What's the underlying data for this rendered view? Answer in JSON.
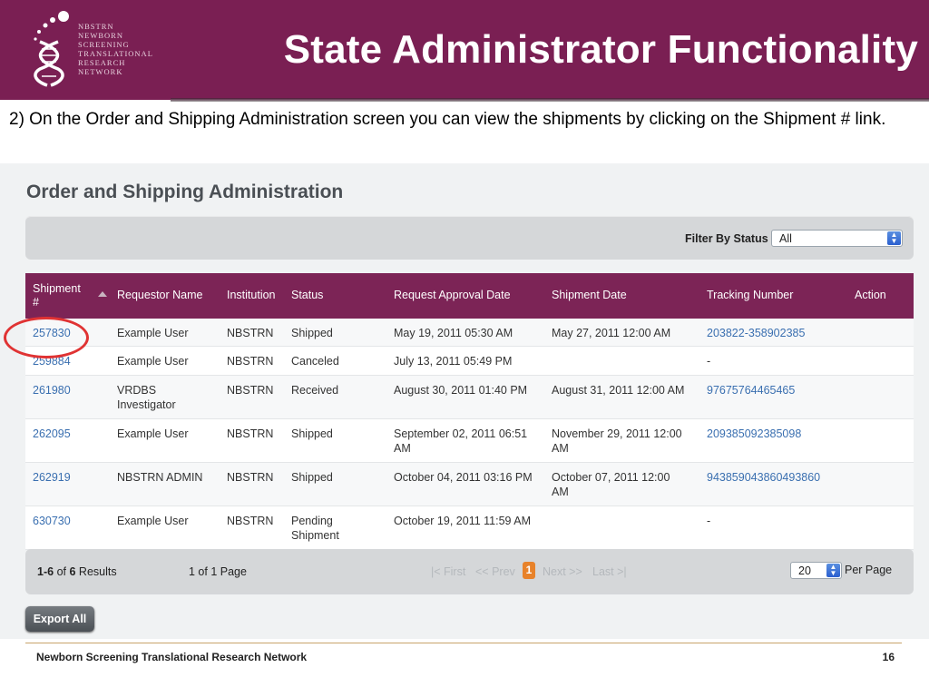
{
  "slide": {
    "title": "State Administrator Functionality",
    "logo_lines": [
      "NBSTRN",
      "NEWBORN",
      "SCREENING",
      "TRANSLATIONAL",
      "RESEARCH",
      "NETWORK"
    ],
    "instruction": "2) On the Order and Shipping Administration screen you can view the shipments by clicking on the Shipment # link.",
    "footer_text": "Newborn Screening Translational Research Network",
    "page_number": "16"
  },
  "app": {
    "title": "Order and Shipping Administration",
    "filter": {
      "label": "Filter By Status",
      "selected": "All"
    },
    "table": {
      "headers": {
        "shipment": "Shipment #",
        "requestor": "Requestor Name",
        "institution": "Institution",
        "status": "Status",
        "approval": "Request Approval Date",
        "shipment_date": "Shipment Date",
        "tracking": "Tracking Number",
        "action": "Action"
      },
      "rows": [
        {
          "shipment": "257830",
          "requestor": "Example User",
          "institution": "NBSTRN",
          "status": "Shipped",
          "approval": "May 19, 2011 05:30 AM",
          "shipment_date": "May 27, 2011 12:00 AM",
          "tracking": "203822-358902385"
        },
        {
          "shipment": "259884",
          "requestor": "Example User",
          "institution": "NBSTRN",
          "status": "Canceled",
          "approval": "July 13, 2011 05:49 PM",
          "shipment_date": "",
          "tracking": "-"
        },
        {
          "shipment": "261980",
          "requestor": "VRDBS Investigator",
          "institution": "NBSTRN",
          "status": "Received",
          "approval": "August 30, 2011 01:40 PM",
          "shipment_date": "August 31, 2011 12:00 AM",
          "tracking": "97675764465465"
        },
        {
          "shipment": "262095",
          "requestor": "Example User",
          "institution": "NBSTRN",
          "status": "Shipped",
          "approval": "September 02, 2011 06:51 AM",
          "shipment_date": "November 29, 2011 12:00 AM",
          "tracking": "209385092385098"
        },
        {
          "shipment": "262919",
          "requestor": "NBSTRN ADMIN",
          "institution": "NBSTRN",
          "status": "Shipped",
          "approval": "October 04, 2011 03:16 PM",
          "shipment_date": "October 07, 2011 12:00 AM",
          "tracking": "943859043860493860"
        },
        {
          "shipment": "630730",
          "requestor": "Example User",
          "institution": "NBSTRN",
          "status": "Pending Shipment",
          "approval": "October 19, 2011 11:59 AM",
          "shipment_date": "",
          "tracking": "-"
        }
      ]
    },
    "pager": {
      "results_range": "1-6",
      "results_of": "of",
      "results_total": "6",
      "results_word": "Results",
      "page_info": "1 of 1 Page",
      "first": "|< First",
      "prev": "<< Prev",
      "current": "1",
      "next": "Next >>",
      "last": "Last >|",
      "per_page_value": "20",
      "per_page_label": "Per Page"
    },
    "export_label": "Export All"
  },
  "colors": {
    "brand": "#7a1f53",
    "header_row": "#7c2456",
    "link": "#3a6fb0",
    "highlight": "#e03333",
    "current_page": "#e8822a"
  }
}
